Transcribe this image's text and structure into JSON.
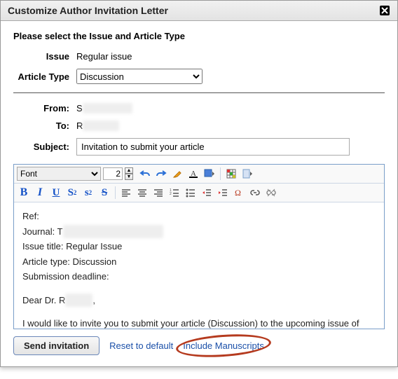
{
  "dialog": {
    "title": "Customize Author Invitation Letter"
  },
  "instruction": "Please select the Issue and Article Type",
  "form": {
    "issue_label": "Issue",
    "issue_value": "Regular issue",
    "article_type_label": "Article Type",
    "article_type_value": "Discussion",
    "from_label": "From:",
    "from_value_visible": "S",
    "to_label": "To:",
    "to_value_visible": "R",
    "subject_label": "Subject:",
    "subject_value": "Invitation to submit your article"
  },
  "toolbar": {
    "font_label": "Font",
    "size_value": "2"
  },
  "body": {
    "ref": "Ref:",
    "journal_prefix": "Journal: T",
    "issue_title": "Issue title: Regular Issue",
    "article_type": "Article type: Discussion",
    "submission_deadline": "Submission deadline:",
    "greeting_prefix": "Dear Dr. R",
    "greeting_suffix": ",",
    "paragraph1": "I would like to invite you to submit your article (Discussion) to the upcoming issue of Test"
  },
  "footer": {
    "send_label": "Send invitation",
    "reset_label": "Reset to default",
    "include_label": "Include Manuscripts"
  }
}
